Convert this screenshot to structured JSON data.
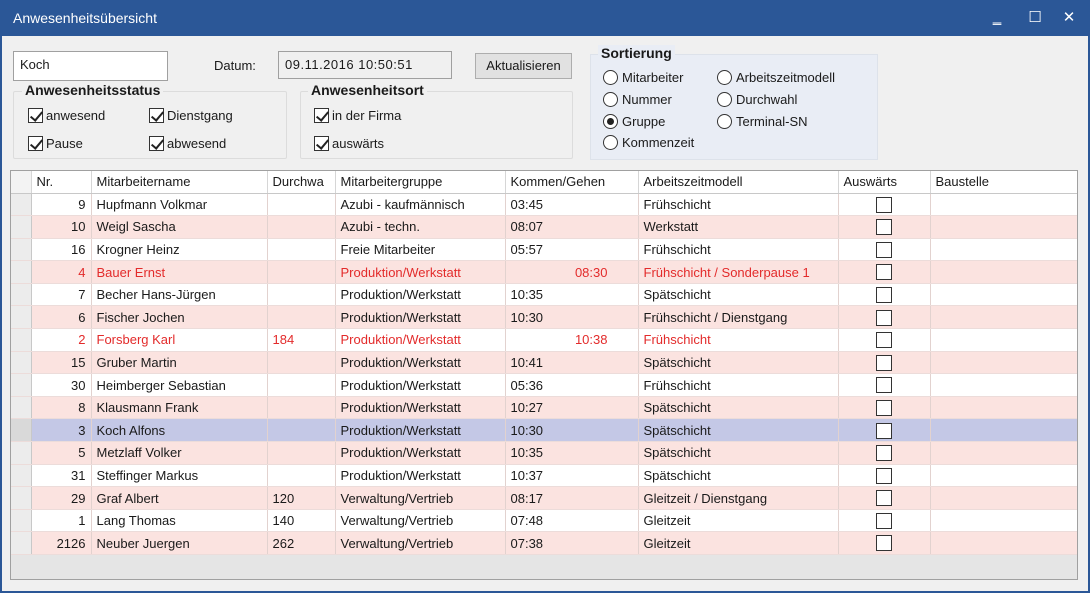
{
  "window": {
    "title": "Anwesenheitsübersicht",
    "minimize": "‗",
    "maximize": "☐",
    "close": "✕"
  },
  "search": {
    "value": "Koch"
  },
  "datum": {
    "label": "Datum:",
    "value": "09.11.2016 10:50:51"
  },
  "refresh_label": "Aktualisieren",
  "status_group": {
    "title": "Anwesenheitsstatus",
    "items": [
      {
        "label": "anwesend",
        "checked": true
      },
      {
        "label": "Dienstgang",
        "checked": true
      },
      {
        "label": "Pause",
        "checked": true
      },
      {
        "label": "abwesend",
        "checked": true
      }
    ]
  },
  "ort_group": {
    "title": "Anwesenheitsort",
    "items": [
      {
        "label": "in der Firma",
        "checked": true
      },
      {
        "label": "auswärts",
        "checked": true
      }
    ]
  },
  "sort_group": {
    "title": "Sortierung",
    "options": [
      {
        "label": "Mitarbeiter",
        "selected": false
      },
      {
        "label": "Nummer",
        "selected": false
      },
      {
        "label": "Gruppe",
        "selected": true
      },
      {
        "label": "Kommenzeit",
        "selected": false
      },
      {
        "label": "Arbeitszeitmodell",
        "selected": false
      },
      {
        "label": "Durchwahl",
        "selected": false
      },
      {
        "label": "Terminal-SN",
        "selected": false
      }
    ]
  },
  "table": {
    "columns": [
      "Nr.",
      "Mitarbeitername",
      "Durchwa",
      "Mitarbeitergruppe",
      "Kommen/Gehen",
      "Arbeitszeitmodell",
      "Auswärts",
      "Baustelle"
    ],
    "rows": [
      {
        "nr": "9",
        "name": "Hupfmann Volkmar",
        "durchwahl": "",
        "gruppe": "Azubi - kaufmännisch",
        "zeit": "03:45",
        "modell": "Frühschicht",
        "red": false
      },
      {
        "nr": "10",
        "name": "Weigl Sascha",
        "durchwahl": "",
        "gruppe": "Azubi - techn.",
        "zeit": "08:07",
        "modell": "Werkstatt",
        "red": false
      },
      {
        "nr": "16",
        "name": "Krogner Heinz",
        "durchwahl": "",
        "gruppe": "Freie Mitarbeiter",
        "zeit": "05:57",
        "modell": "Frühschicht",
        "red": false
      },
      {
        "nr": "4",
        "name": "Bauer Ernst",
        "durchwahl": "",
        "gruppe": "Produktion/Werkstatt",
        "zeit": "08:30",
        "modell": "Frühschicht / Sonderpause 1",
        "red": true
      },
      {
        "nr": "7",
        "name": "Becher Hans-Jürgen",
        "durchwahl": "",
        "gruppe": "Produktion/Werkstatt",
        "zeit": "10:35",
        "modell": "Spätschicht",
        "red": false
      },
      {
        "nr": "6",
        "name": "Fischer Jochen",
        "durchwahl": "",
        "gruppe": "Produktion/Werkstatt",
        "zeit": "10:30",
        "modell": "Frühschicht / Dienstgang",
        "red": false
      },
      {
        "nr": "2",
        "name": "Forsberg Karl",
        "durchwahl": "184",
        "gruppe": "Produktion/Werkstatt",
        "zeit": "10:38",
        "modell": "Frühschicht",
        "red": true
      },
      {
        "nr": "15",
        "name": "Gruber Martin",
        "durchwahl": "",
        "gruppe": "Produktion/Werkstatt",
        "zeit": "10:41",
        "modell": "Spätschicht",
        "red": false
      },
      {
        "nr": "30",
        "name": "Heimberger Sebastian",
        "durchwahl": "",
        "gruppe": "Produktion/Werkstatt",
        "zeit": "05:36",
        "modell": "Frühschicht",
        "red": false
      },
      {
        "nr": "8",
        "name": "Klausmann Frank",
        "durchwahl": "",
        "gruppe": "Produktion/Werkstatt",
        "zeit": "10:27",
        "modell": "Spätschicht",
        "red": false
      },
      {
        "nr": "3",
        "name": "Koch Alfons",
        "durchwahl": "",
        "gruppe": "Produktion/Werkstatt",
        "zeit": "10:30",
        "modell": "Spätschicht",
        "red": false,
        "selected": true
      },
      {
        "nr": "5",
        "name": "Metzlaff Volker",
        "durchwahl": "",
        "gruppe": "Produktion/Werkstatt",
        "zeit": "10:35",
        "modell": "Spätschicht",
        "red": false
      },
      {
        "nr": "31",
        "name": "Steffinger Markus",
        "durchwahl": "",
        "gruppe": "Produktion/Werkstatt",
        "zeit": "10:37",
        "modell": "Spätschicht",
        "red": false
      },
      {
        "nr": "29",
        "name": "Graf Albert",
        "durchwahl": "120",
        "gruppe": "Verwaltung/Vertrieb",
        "zeit": "08:17",
        "modell": "Gleitzeit / Dienstgang",
        "red": false
      },
      {
        "nr": "1",
        "name": "Lang Thomas",
        "durchwahl": "140",
        "gruppe": "Verwaltung/Vertrieb",
        "zeit": "07:48",
        "modell": "Gleitzeit",
        "red": false
      },
      {
        "nr": "2126",
        "name": "Neuber Juergen",
        "durchwahl": "262",
        "gruppe": "Verwaltung/Vertrieb",
        "zeit": "07:38",
        "modell": "Gleitzeit",
        "red": false
      }
    ]
  }
}
